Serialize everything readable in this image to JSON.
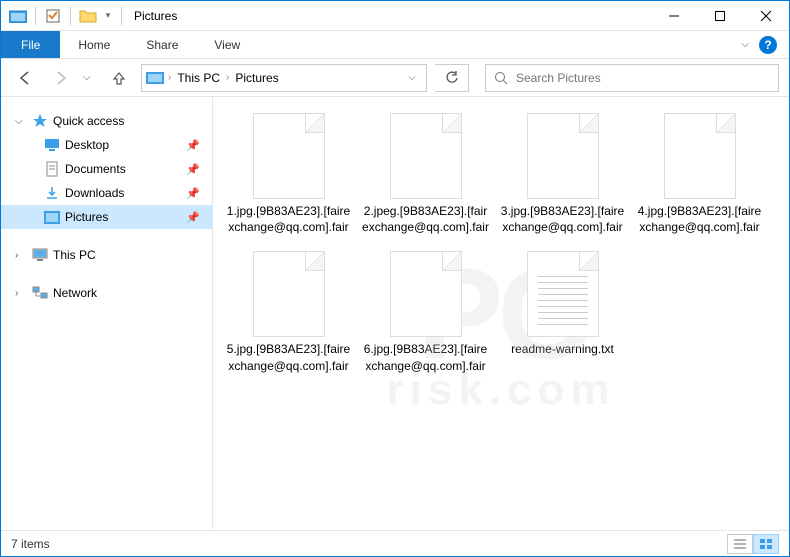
{
  "titlebar": {
    "title": "Pictures"
  },
  "ribbon": {
    "file": "File",
    "tabs": [
      "Home",
      "Share",
      "View"
    ]
  },
  "address": {
    "crumbs": [
      "This PC",
      "Pictures"
    ]
  },
  "search": {
    "placeholder": "Search Pictures"
  },
  "sidebar": {
    "quick_access": "Quick access",
    "items": [
      {
        "label": "Desktop",
        "icon": "desktop"
      },
      {
        "label": "Documents",
        "icon": "documents"
      },
      {
        "label": "Downloads",
        "icon": "downloads"
      },
      {
        "label": "Pictures",
        "icon": "pictures",
        "selected": true
      }
    ],
    "this_pc": "This PC",
    "network": "Network"
  },
  "files": [
    {
      "name": "1.jpg.[9B83AE23].[fairexchange@qq.com].fair",
      "type": "file"
    },
    {
      "name": "2.jpeg.[9B83AE23].[fairexchange@qq.com].fair",
      "type": "file"
    },
    {
      "name": "3.jpg.[9B83AE23].[fairexchange@qq.com].fair",
      "type": "file"
    },
    {
      "name": "4.jpg.[9B83AE23].[fairexchange@qq.com].fair",
      "type": "file"
    },
    {
      "name": "5.jpg.[9B83AE23].[fairexchange@qq.com].fair",
      "type": "file"
    },
    {
      "name": "6.jpg.[9B83AE23].[fairexchange@qq.com].fair",
      "type": "file"
    },
    {
      "name": "readme-warning.txt",
      "type": "txt"
    }
  ],
  "status": {
    "count": "7 items"
  },
  "watermark": {
    "main": "PC",
    "sub": "risk.com"
  }
}
